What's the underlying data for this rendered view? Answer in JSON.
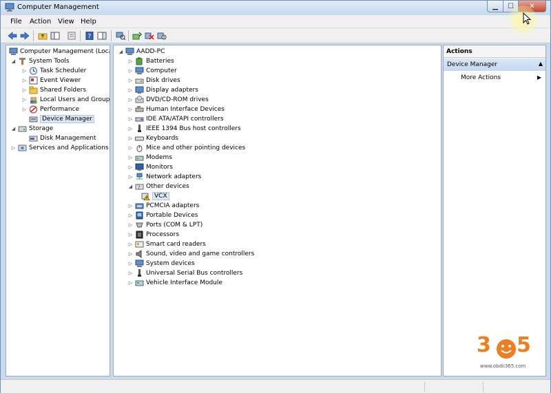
{
  "window": {
    "title": "Computer Management"
  },
  "menubar": {
    "items": [
      "File",
      "Action",
      "View",
      "Help"
    ]
  },
  "left_tree": {
    "root": "Computer Management (Local",
    "system_tools": "System Tools",
    "task_scheduler": "Task Scheduler",
    "event_viewer": "Event Viewer",
    "shared_folders": "Shared Folders",
    "local_users": "Local Users and Groups",
    "performance": "Performance",
    "device_manager": "Device Manager",
    "storage": "Storage",
    "disk_management": "Disk Management",
    "services": "Services and Applications"
  },
  "device_tree": {
    "root": "AADD-PC",
    "items": [
      "Batteries",
      "Computer",
      "Disk drives",
      "Display adapters",
      "DVD/CD-ROM drives",
      "Human Interface Devices",
      "IDE ATA/ATAPI controllers",
      "IEEE 1394 Bus host controllers",
      "Keyboards",
      "Mice and other pointing devices",
      "Modems",
      "Monitors",
      "Network adapters",
      "Other devices",
      "VCX",
      "PCMCIA adapters",
      "Portable Devices",
      "Ports (COM & LPT)",
      "Processors",
      "Smart card readers",
      "Sound, video and game controllers",
      "System devices",
      "Universal Serial Bus controllers",
      "Vehicle Interface Module"
    ]
  },
  "actions": {
    "header": "Actions",
    "section": "Device Manager",
    "more": "More Actions"
  },
  "watermark": {
    "logo_digits": [
      "3",
      "6",
      "5"
    ],
    "url": "www.obdii365.com"
  },
  "colors": {
    "title_gradient_top": "#dfeaf6",
    "selection": "#dde7f4",
    "close_button": "#c4442c",
    "logo_orange": "#f07d1e"
  }
}
